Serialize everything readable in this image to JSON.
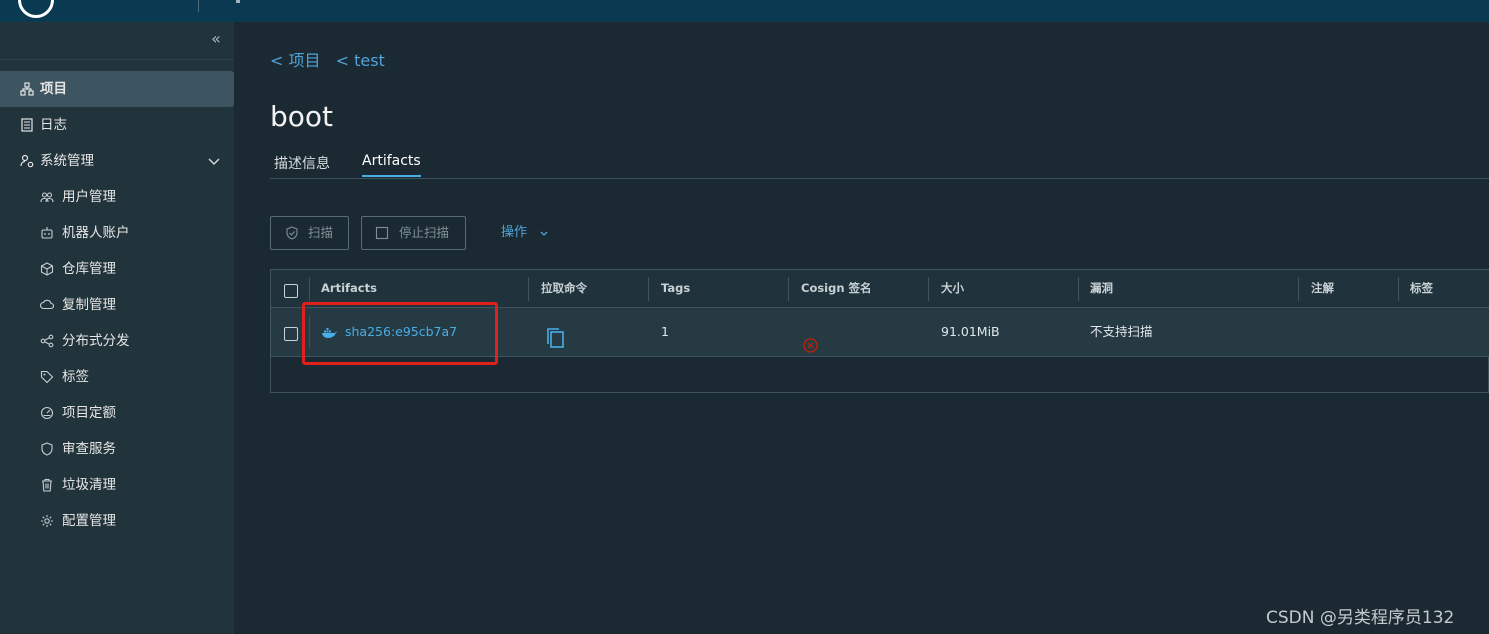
{
  "breadcrumbs": [
    "< 项目",
    "< test"
  ],
  "page_title": "boot",
  "tabs": [
    {
      "label": "描述信息",
      "active": false
    },
    {
      "label": "Artifacts",
      "active": true
    }
  ],
  "sidebar": {
    "items": [
      {
        "label": "项目",
        "icon": "projects-icon",
        "active": true
      },
      {
        "label": "日志",
        "icon": "logs-icon",
        "active": false
      },
      {
        "label": "系统管理",
        "icon": "system-admin-icon",
        "active": false,
        "expanded": true
      }
    ],
    "sub_items": [
      {
        "label": "用户管理",
        "icon": "users-icon"
      },
      {
        "label": "机器人账户",
        "icon": "robot-icon"
      },
      {
        "label": "仓库管理",
        "icon": "registry-icon"
      },
      {
        "label": "复制管理",
        "icon": "replication-icon"
      },
      {
        "label": "分布式分发",
        "icon": "distribution-icon"
      },
      {
        "label": "标签",
        "icon": "tag-icon"
      },
      {
        "label": "项目定额",
        "icon": "quota-icon"
      },
      {
        "label": "审查服务",
        "icon": "shield-icon"
      },
      {
        "label": "垃圾清理",
        "icon": "trash-icon"
      },
      {
        "label": "配置管理",
        "icon": "gear-icon"
      }
    ]
  },
  "toolbar": {
    "scan_label": "扫描",
    "stop_scan_label": "停止扫描",
    "actions_label": "操作"
  },
  "table": {
    "columns": [
      "Artifacts",
      "拉取命令",
      "Tags",
      "Cosign 签名",
      "大小",
      "漏洞",
      "注解",
      "标签"
    ],
    "rows": [
      {
        "artifact": "sha256:e95cb7a7",
        "tags": "1",
        "cosign": "unsigned",
        "size": "91.01MiB",
        "vulnerabilities": "不支持扫描",
        "annotations": "",
        "labels": ""
      }
    ]
  },
  "watermark": "CSDN @另类程序员132",
  "colors": {
    "accent": "#49aee6",
    "highlight_box": "#e0211b",
    "cosign_error": "#c92100"
  }
}
